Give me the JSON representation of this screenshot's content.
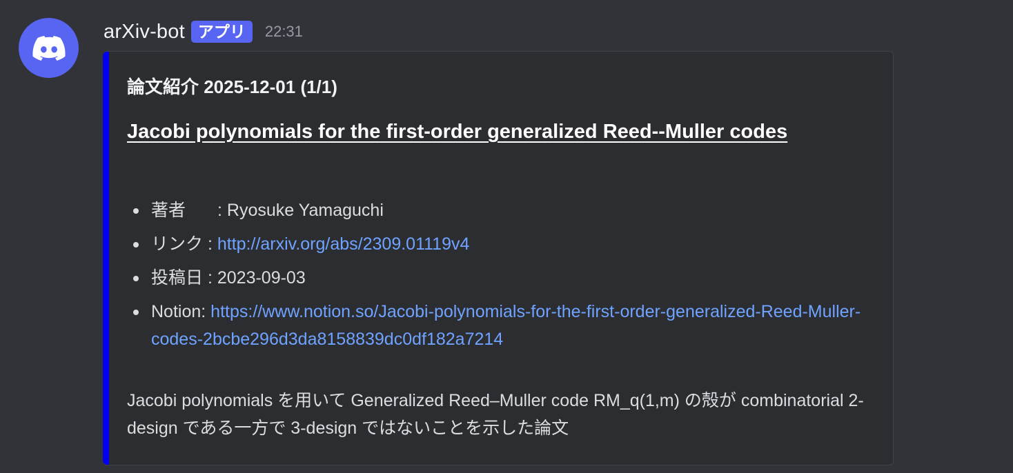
{
  "message": {
    "username": "arXiv-bot",
    "badge": "アプリ",
    "timestamp": "22:31",
    "avatar_icon": "discord-logo-icon"
  },
  "embed": {
    "accent_color": "#0000ee",
    "author": "論文紹介 2025-12-01 (1/1)",
    "title": "Jacobi polynomials for the first-order generalized Reed--Muller codes",
    "fields": {
      "authors": {
        "label": "著者",
        "sep": ": ",
        "value": "Ryosuke Yamaguchi"
      },
      "link": {
        "label": "リンク",
        "sep": " : ",
        "value": "http://arxiv.org/abs/2309.01119v4"
      },
      "date": {
        "label": "投稿日",
        "sep": " : ",
        "value": "2023-09-03"
      },
      "notion": {
        "label": "Notion",
        "sep": ": ",
        "value": "https://www.notion.so/Jacobi-polynomials-for-the-first-order-generalized-Reed-Muller-codes-2bcbe296d3da8158839dc0df182a7214"
      }
    },
    "description": "Jacobi polynomials を用いて Generalized Reed–Muller code RM_q(1,m) の殻が combinatorial 2-design である一方で 3-design ではないことを示した論文"
  }
}
